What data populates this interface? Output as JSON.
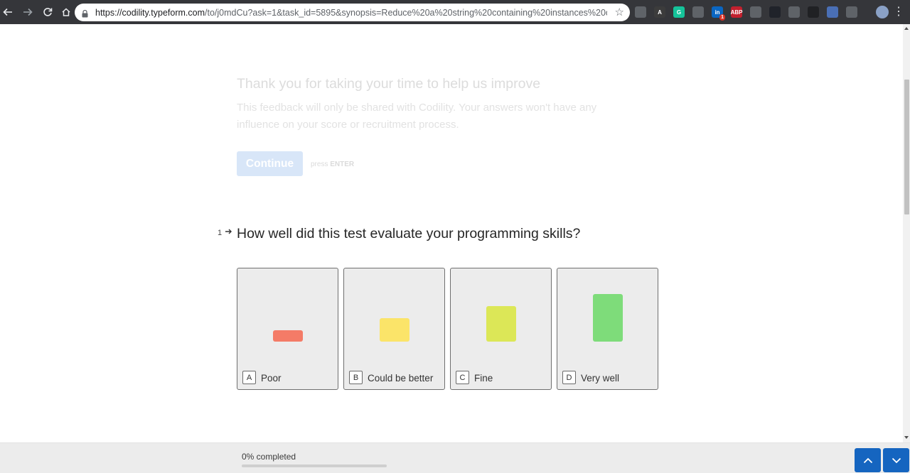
{
  "browser": {
    "url_host": "https://codility.typeform.com",
    "url_path": "/to/j0mdCu?ask=1&task_id=5895&synopsis=Reduce%20a%20string%20containing%20instances%20of%2...",
    "extensions": [
      {
        "name": "bulb-extension",
        "color": "#5f6368",
        "text": ""
      },
      {
        "name": "font-extension",
        "color": "#3c3c3c",
        "text": "A"
      },
      {
        "name": "grammarly-extension",
        "color": "#15c39a",
        "text": "G"
      },
      {
        "name": "pin-extension",
        "color": "#5f6368",
        "text": ""
      },
      {
        "name": "linkedin-extension",
        "color": "#0a66c2",
        "text": "in"
      },
      {
        "name": "adblock-extension",
        "color": "#c2202e",
        "text": "ABP"
      },
      {
        "name": "download-extension",
        "color": "#5f6368",
        "text": ""
      },
      {
        "name": "react-extension",
        "color": "#20232a",
        "text": ""
      },
      {
        "name": "chat-extension",
        "color": "#5f6368",
        "text": ""
      },
      {
        "name": "hat-extension",
        "color": "#202124",
        "text": ""
      },
      {
        "name": "people-extension",
        "color": "#4a6fb5",
        "text": ""
      },
      {
        "name": "window-extension",
        "color": "#5f6368",
        "text": ""
      }
    ],
    "linkedin_badge": "1"
  },
  "welcome": {
    "title": "Thank you for taking your time to help us improve",
    "description": "This feedback will only be shared with Codility. Your answers won't have any influence on your score or recruitment process.",
    "continue_label": "Continue",
    "hint_press": "press",
    "hint_key": "ENTER"
  },
  "question": {
    "number": "1",
    "title": "How well did this test evaluate your programming skills?",
    "options": [
      {
        "key": "A",
        "label": "Poor",
        "bar_color": "#f47b67"
      },
      {
        "key": "B",
        "label": "Could be better",
        "bar_color": "#fbe469"
      },
      {
        "key": "C",
        "label": "Fine",
        "bar_color": "#dce757"
      },
      {
        "key": "D",
        "label": "Very well",
        "bar_color": "#7edc7a"
      }
    ]
  },
  "footer": {
    "progress_text": "0% completed",
    "progress_value": 0,
    "accent": "#1565c0"
  }
}
